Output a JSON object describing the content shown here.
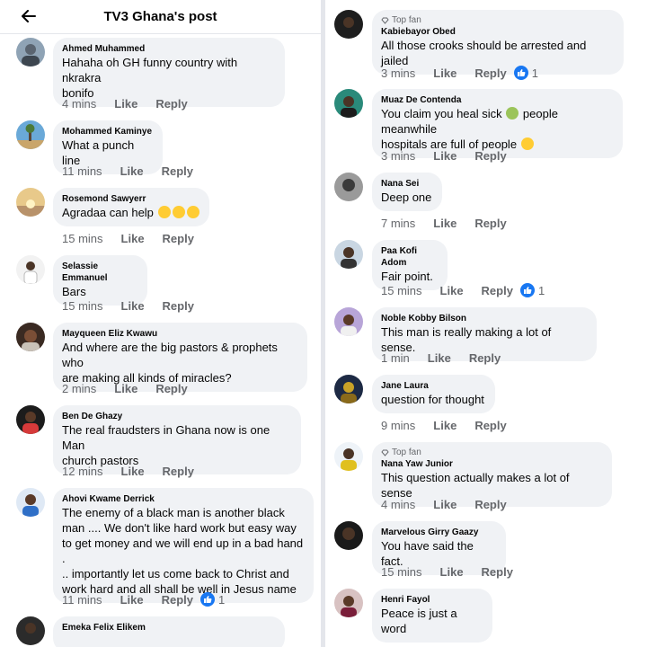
{
  "header": {
    "title": "TV3 Ghana's post",
    "back_icon": "arrow-left-icon"
  },
  "colors": {
    "bubble": "#f0f2f5",
    "meta": "#65676b",
    "like_blue": "#1877f2",
    "divider": "#e4e6eb"
  },
  "left_comments": [
    {
      "name": "Ahmed Muhammed",
      "text_lines": [
        "Hahaha oh GH funny country with nkrakra",
        "bonifo"
      ],
      "time": "4 mins",
      "like": "Like",
      "reply": "Reply"
    },
    {
      "name": "Mohammed Kaminye",
      "text_lines": [
        "What a punch line"
      ],
      "time": "11 mins",
      "like": "Like",
      "reply": "Reply"
    },
    {
      "name": "Rosemond Sawyerr",
      "text_lines": [
        "Agradaa can help"
      ],
      "emojis": [
        "laughing-face-emoji",
        "grinning-sweat-emoji",
        "monocle-face-emoji"
      ],
      "time": "15 mins",
      "like": "Like",
      "reply": "Reply"
    },
    {
      "name": "Selassie Emmanuel",
      "text_lines": [
        "Bars"
      ],
      "time": "15 mins",
      "like": "Like",
      "reply": "Reply"
    },
    {
      "name": "Mayqueen Eliz Kwawu",
      "text_lines": [
        "And where are the big pastors & prophets who",
        "are making all kinds of miracles?"
      ],
      "time": "2 mins",
      "like": "Like",
      "reply": "Reply"
    },
    {
      "name": "Ben De Ghazy",
      "text_lines": [
        "The real fraudsters in Ghana now is one Man",
        "church pastors"
      ],
      "time": "12 mins",
      "like": "Like",
      "reply": "Reply"
    },
    {
      "name": "Ahovi Kwame Derrick",
      "text_lines": [
        "The enemy of a black man is another black",
        "man .... We don't like hard work but easy way",
        "to get money and we will end up in a bad hand .",
        ".. importantly let us come back to Christ and",
        "work hard and all shall be well in Jesus name"
      ],
      "time": "11 mins",
      "like": "Like",
      "reply": "Reply",
      "reactions": "1"
    },
    {
      "name": "Emeka Felix Elikem",
      "text_lines": [
        ""
      ],
      "time": "",
      "like": "",
      "reply": ""
    }
  ],
  "right_comments": [
    {
      "badge": "Top fan",
      "name": "Kabiebayor Obed",
      "text_lines": [
        "All those crooks should be arrested and jailed"
      ],
      "time": "3 mins",
      "like": "Like",
      "reply": "Reply",
      "reactions": "1"
    },
    {
      "name": "Muaz De Contenda",
      "text_lines": [
        "You claim you heal sick",
        "hospitals are full of people"
      ],
      "emojis": [
        "nauseated-face-emoji",
        "grinning-sweat-emoji"
      ],
      "after_emoji_text": "people meanwhile",
      "time": "3 mins",
      "like": "Like",
      "reply": "Reply"
    },
    {
      "name": "Nana Sei",
      "text_lines": [
        "Deep one"
      ],
      "time": "7 mins",
      "like": "Like",
      "reply": "Reply"
    },
    {
      "name": "Paa Kofi Adom",
      "text_lines": [
        "Fair point."
      ],
      "time": "15 mins",
      "like": "Like",
      "reply": "Reply",
      "reactions": "1"
    },
    {
      "name": "Noble Kobby Bilson",
      "text_lines": [
        "This man is really making a lot of sense."
      ],
      "time": "1 min",
      "like": "Like",
      "reply": "Reply"
    },
    {
      "name": "Jane Laura",
      "text_lines": [
        "question for thought"
      ],
      "time": "9 mins",
      "like": "Like",
      "reply": "Reply"
    },
    {
      "badge": "Top fan",
      "name": "Nana Yaw Junior",
      "text_lines": [
        "This question actually makes a lot of sense"
      ],
      "time": "4 mins",
      "like": "Like",
      "reply": "Reply"
    },
    {
      "name": "Marvelous Girry Gaazy",
      "text_lines": [
        "You have said the fact."
      ],
      "time": "15 mins",
      "like": "Like",
      "reply": "Reply"
    },
    {
      "name": "Henri Fayol",
      "text_lines": [
        "Peace is just a word"
      ],
      "time": "",
      "like": "",
      "reply": ""
    }
  ]
}
